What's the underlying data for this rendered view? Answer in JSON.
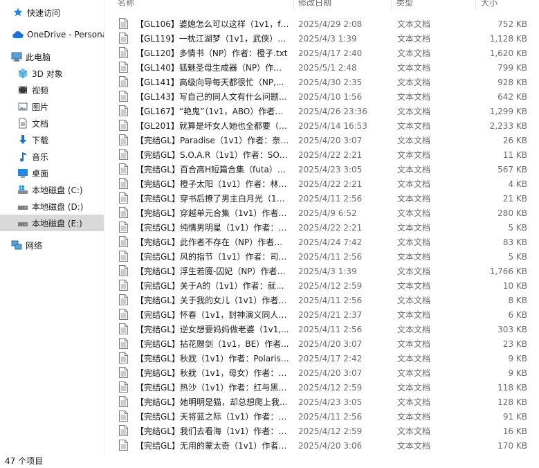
{
  "nav": {
    "quick_access": "快速访问",
    "onedrive": "OneDrive - Persona",
    "this_pc": "此电脑",
    "objects3d": "3D 对象",
    "videos": "视频",
    "pictures": "图片",
    "documents": "文档",
    "downloads": "下载",
    "music": "音乐",
    "desktop": "桌面",
    "drive_c": "本地磁盘 (C:)",
    "drive_d": "本地磁盘 (D:)",
    "drive_e": "本地磁盘 (E:)",
    "network": "网络"
  },
  "columns": {
    "name": "名称",
    "date": "修改日期",
    "type": "类型",
    "size": "大小"
  },
  "files": [
    {
      "name": "【GL106】婆媳怎么可以这样（1v1，fut...",
      "date": "2025/4/29 2:08",
      "type": "文本文档",
      "size": "752 KB"
    },
    {
      "name": "【GL119】一枕江湖梦（1v1，武侠）作...",
      "date": "2025/4/3 1:39",
      "type": "文本文档",
      "size": "1,128 KB"
    },
    {
      "name": "【GL120】多情书（NP）作者：橙子.txt",
      "date": "2025/4/17 2:40",
      "type": "文本文档",
      "size": "1,620 KB"
    },
    {
      "name": "【GL140】狐魅圣母生成器（NP）作者...",
      "date": "2025/5/1 2:48",
      "type": "文本文档",
      "size": "799 KB"
    },
    {
      "name": "【GL141】高级向导每天都很忙（NP,...",
      "date": "2025/4/30 2:35",
      "type": "文本文档",
      "size": "928 KB"
    },
    {
      "name": "【GL143】写自己的同人文有什么问题（...",
      "date": "2025/4/10 1:56",
      "type": "文本文档",
      "size": "642 KB"
    },
    {
      "name": "【GL167】“艳鬼”（1v1，ABO）作者：...",
      "date": "2025/4/26 23:36",
      "type": "文本文档",
      "size": "1,299 KB"
    },
    {
      "name": "【GL201】就算是坏女人她也全都要（N...",
      "date": "2025/4/14 16:53",
      "type": "文本文档",
      "size": "2,233 KB"
    },
    {
      "name": "【完结GL】Paradise（1v1）作者：奈致...",
      "date": "2025/4/20 3:07",
      "type": "文本文档",
      "size": "26 KB"
    },
    {
      "name": "【完结GL】S.O.A.R（1v1）作者：SOL...",
      "date": "2025/4/22 2:21",
      "type": "文本文档",
      "size": "11 KB"
    },
    {
      "name": "【完结GL】百合高H短篇合集（futa）作...",
      "date": "2025/4/23 3:05",
      "type": "文本文档",
      "size": "567 KB"
    },
    {
      "name": "【完结GL】橙子太阳（1v1）作者：林中...",
      "date": "2025/4/22 2:21",
      "type": "文本文档",
      "size": "4 KB"
    },
    {
      "name": "【完结GL】穿书后撩了男主白月光（1v1...",
      "date": "2025/4/11 2:56",
      "type": "文本文档",
      "size": "21 KB"
    },
    {
      "name": "【完结GL】穿越单元合集（1v1）作者：...",
      "date": "2025/4/9 6:52",
      "type": "文本文档",
      "size": "280 KB"
    },
    {
      "name": "【完结GL】纯情男明星（1v1）作者：烦...",
      "date": "2025/4/22 2:21",
      "type": "文本文档",
      "size": "5 KB"
    },
    {
      "name": "【完结GL】此作者不存在（NP）作者：...",
      "date": "2025/4/24 7:42",
      "type": "文本文档",
      "size": "83 KB"
    },
    {
      "name": "【完结GL】风的指节（1v1）作者：司倦...",
      "date": "2025/4/11 2:56",
      "type": "文本文档",
      "size": "5 KB"
    },
    {
      "name": "【完结GL】浮生若魇-囚妃（NP）作者：...",
      "date": "2025/4/3 1:39",
      "type": "文本文档",
      "size": "1,766 KB"
    },
    {
      "name": "【完结GL】关于A的（1v1）作者：就这...",
      "date": "2025/4/12 2:59",
      "type": "文本文档",
      "size": "10 KB"
    },
    {
      "name": "【完结GL】关于我的女儿（1v1）作者：...",
      "date": "2025/4/11 2:56",
      "type": "文本文档",
      "size": "8 KB"
    },
    {
      "name": "【完结GL】怀春（1v1，封神演义同人）...",
      "date": "2025/4/21 2:37",
      "type": "文本文档",
      "size": "6 KB"
    },
    {
      "name": "【完结GL】逆女想要妈妈做老婆（1v1,...",
      "date": "2025/4/11 2:56",
      "type": "文本文档",
      "size": "303 KB"
    },
    {
      "name": "【完结GL】拈花赠剑（1v1，BE）作者...",
      "date": "2025/4/20 3:07",
      "type": "文本文档",
      "size": "23 KB"
    },
    {
      "name": "【完结GL】秋戕（1v1）作者：Polaris.txt",
      "date": "2025/4/17 2:42",
      "type": "文本文档",
      "size": "9 KB"
    },
    {
      "name": "【完结GL】秋戕（1v1，母女）作者：ka...",
      "date": "2025/4/20 3:07",
      "type": "文本文档",
      "size": "9 KB"
    },
    {
      "name": "【完结GL】热沙（1v1）作者：红与黑的...",
      "date": "2025/4/12 2:59",
      "type": "文本文档",
      "size": "118 KB"
    },
    {
      "name": "【完结GL】她明明是猫，却总想爬上我...",
      "date": "2025/4/23 3:05",
      "type": "文本文档",
      "size": "128 KB"
    },
    {
      "name": "【完结GL】天将蓝之际（1v1）作者：zff...",
      "date": "2025/4/11 2:56",
      "type": "文本文档",
      "size": "91 KB"
    },
    {
      "name": "【完结GL】我们去看海（1v1）作者：匿...",
      "date": "2025/4/12 2:59",
      "type": "文本文档",
      "size": "16 KB"
    },
    {
      "name": "【完结GL】无用的蒙太奇（1v1）作者：...",
      "date": "2025/4/20 3:06",
      "type": "文本文档",
      "size": "170 KB"
    }
  ],
  "status": {
    "item_count": "47 个项目"
  }
}
